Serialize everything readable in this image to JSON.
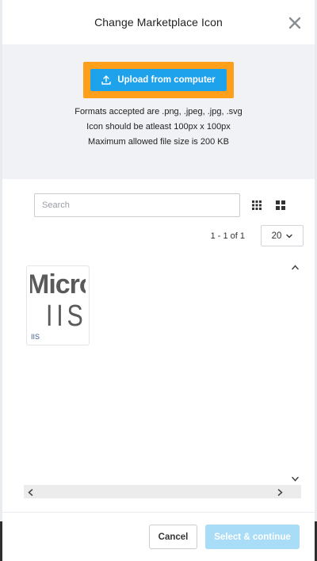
{
  "modal": {
    "title": "Change Marketplace Icon",
    "close_icon": "close-icon"
  },
  "upload": {
    "button_label": "Upload from computer",
    "button_icon": "upload-icon",
    "formats_text": "Formats accepted are .png, .jpeg, .jpg, .svg",
    "size_text": "Icon should be atleast 100px x 100px",
    "max_size_text": "Maximum allowed file size is 200 KB",
    "accent_color": "#1ea2ec",
    "highlight_color": "#ff9f1a"
  },
  "search": {
    "placeholder": "Search",
    "value": ""
  },
  "view_toggle": {
    "grid_small_icon": "grid-small-icon",
    "grid_large_icon": "grid-large-icon"
  },
  "pagination": {
    "range_text": "1 - 1 of 1",
    "page_size": "20"
  },
  "gallery": {
    "items": [
      {
        "name": "IIS",
        "thumb_line1": "Micro",
        "thumb_line2": "IIS"
      }
    ]
  },
  "footer": {
    "cancel_label": "Cancel",
    "primary_label": "Select & continue"
  }
}
